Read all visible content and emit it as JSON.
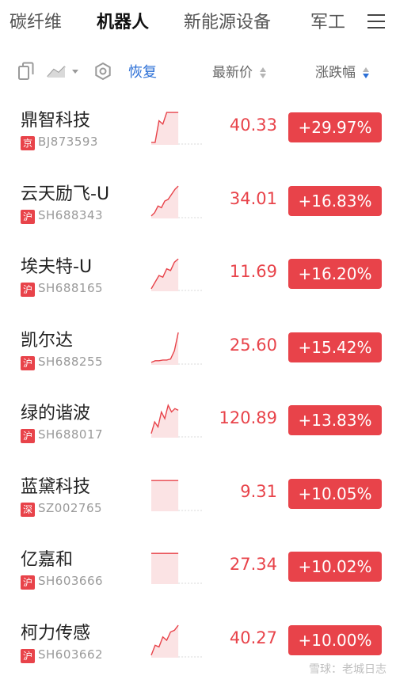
{
  "tabs": [
    {
      "label": "碳纤维"
    },
    {
      "label": "机器人"
    },
    {
      "label": "新能源设备"
    },
    {
      "label": "军工"
    }
  ],
  "toolbar": {
    "restore_label": "恢复",
    "price_header": "最新价",
    "change_header": "涨跌幅"
  },
  "stocks": [
    {
      "name": "鼎智科技",
      "exchange": "京",
      "code": "BJ873593",
      "price": "40.33",
      "change": "+29.97%",
      "trend": [
        0.05,
        0.05,
        0.7,
        0.6,
        0.95,
        0.95,
        0.95,
        0.95
      ],
      "trend_fraction": 0.55
    },
    {
      "name": "云天励飞-U",
      "exchange": "沪",
      "code": "SH688343",
      "price": "34.01",
      "change": "+16.83%",
      "trend": [
        0.05,
        0.15,
        0.35,
        0.3,
        0.5,
        0.55,
        0.7,
        0.85,
        0.95
      ],
      "trend_fraction": 0.55
    },
    {
      "name": "埃夫特-U",
      "exchange": "沪",
      "code": "SH688165",
      "price": "11.69",
      "change": "+16.20%",
      "trend": [
        0.05,
        0.25,
        0.45,
        0.4,
        0.65,
        0.6,
        0.85,
        0.95
      ],
      "trend_fraction": 0.55
    },
    {
      "name": "凯尔达",
      "exchange": "沪",
      "code": "SH688255",
      "price": "25.60",
      "change": "+15.42%",
      "trend": [
        0.05,
        0.1,
        0.1,
        0.12,
        0.12,
        0.15,
        0.4,
        0.95
      ],
      "trend_fraction": 0.55
    },
    {
      "name": "绿的谐波",
      "exchange": "沪",
      "code": "SH688017",
      "price": "120.89",
      "change": "+13.83%",
      "trend": [
        0.1,
        0.45,
        0.3,
        0.75,
        0.55,
        0.95,
        0.75,
        0.85,
        0.8
      ],
      "trend_fraction": 0.55
    },
    {
      "name": "蓝黛科技",
      "exchange": "深",
      "code": "SZ002765",
      "price": "9.31",
      "change": "+10.05%",
      "trend": [
        0.9,
        0.9
      ],
      "trend_fraction": 0.55
    },
    {
      "name": "亿嘉和",
      "exchange": "沪",
      "code": "SH603666",
      "price": "27.34",
      "change": "+10.02%",
      "trend": [
        0.9,
        0.9
      ],
      "trend_fraction": 0.55
    },
    {
      "name": "柯力传感",
      "exchange": "沪",
      "code": "SH603662",
      "price": "40.27",
      "change": "+10.00%",
      "trend": [
        0.05,
        0.35,
        0.3,
        0.6,
        0.5,
        0.75,
        0.8,
        0.95
      ],
      "trend_fraction": 0.55
    }
  ],
  "colors": {
    "up": "#e8434a",
    "accent": "#2b6fd6"
  },
  "icons": [
    "copy-icon",
    "line-chart-icon",
    "settings-icon",
    "menu-icon"
  ],
  "watermark": "雪球：老城日志"
}
